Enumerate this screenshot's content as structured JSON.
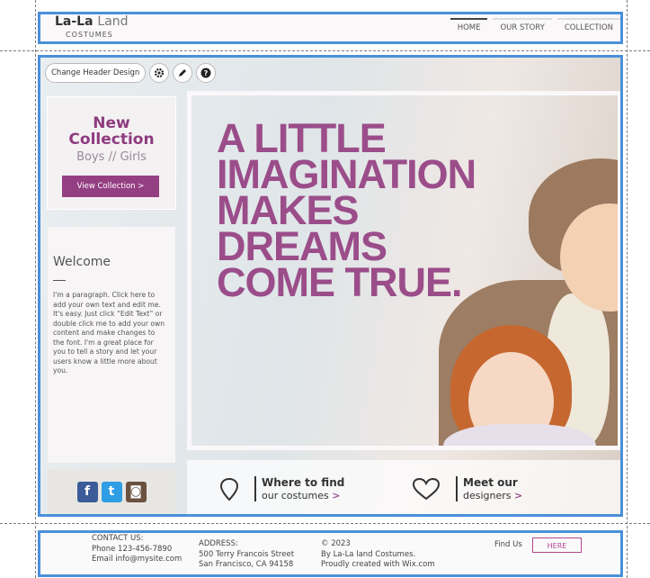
{
  "header": {
    "logo_main_bold": "La-La",
    "logo_main_light": "Land",
    "logo_sub": "COSTUMES",
    "nav": [
      {
        "label": "HOME",
        "active": true
      },
      {
        "label": "OUR STORY",
        "active": false
      },
      {
        "label": "COLLECTION",
        "active": false
      }
    ]
  },
  "toolbar": {
    "change_header_label": "Change Header Design",
    "icons": [
      "gear-icon",
      "pencil-icon",
      "help-icon"
    ]
  },
  "promo": {
    "line1": "New",
    "line2": "Collection",
    "subtitle": "Boys // Girls",
    "button_label": "View Collection >"
  },
  "welcome": {
    "title": "Welcome",
    "paragraph": "I'm a paragraph. Click here to add your own text and edit me. It's easy. Just click “Edit Text” or double click me to add your own content and make changes to the font. I'm a great place for you to tell a story and let your users know a little more about you."
  },
  "social": {
    "icons": [
      "facebook-icon",
      "twitter-icon",
      "instagram-icon"
    ],
    "glyphs": {
      "facebook": "f",
      "twitter": "t",
      "instagram": "◙"
    }
  },
  "hero": {
    "lines": [
      "A LITTLE",
      "IMAGINATION",
      "MAKES",
      "DREAMS",
      "COME TRUE."
    ]
  },
  "cta": {
    "find": {
      "title": "Where to find",
      "sub": "our costumes",
      "arrow": ">"
    },
    "designers": {
      "title": "Meet our",
      "sub": "designers",
      "arrow": ">"
    }
  },
  "footer": {
    "contact_heading": "CONTACT US:",
    "phone": "Phone 123-456-7890",
    "email": "Email info@mysite.com",
    "address_heading": "ADDRESS:",
    "address_line1": "500 Terry Francois Street",
    "address_line2": "San Francisco, CA 94158",
    "copyright": "© 2023",
    "copyright_line2": "By La-La land Costumes.",
    "copyright_line3": "Proudly created with Wix.com",
    "find_us_label": "Find Us",
    "here_button": "HERE"
  },
  "colors": {
    "accent": "#9b4d8a",
    "selection": "#4a90d9"
  }
}
